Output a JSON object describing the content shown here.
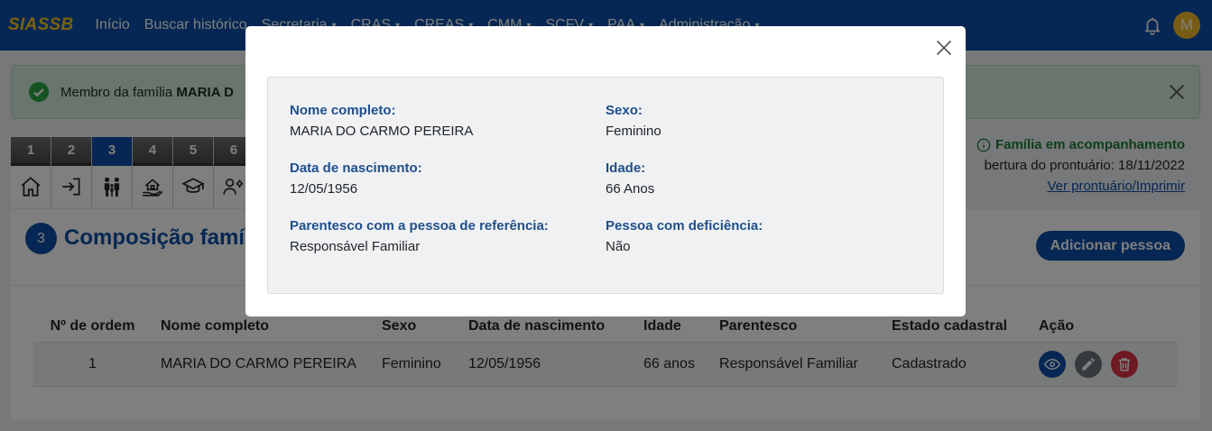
{
  "navbar": {
    "brand": "SIASSB",
    "items": [
      {
        "label": "Início",
        "has_caret": false
      },
      {
        "label": "Buscar histórico",
        "has_caret": false
      },
      {
        "label": "Secretaria",
        "has_caret": true
      },
      {
        "label": "CRAS",
        "has_caret": true
      },
      {
        "label": "CREAS",
        "has_caret": true
      },
      {
        "label": "CMM",
        "has_caret": true
      },
      {
        "label": "SCFV",
        "has_caret": true
      },
      {
        "label": "PAA",
        "has_caret": true
      },
      {
        "label": "Administração",
        "has_caret": true
      }
    ],
    "caret": "▾",
    "avatar_initial": "M",
    "icons": [
      "bell-icon",
      "avatar"
    ]
  },
  "alert": {
    "text_prefix": "Membro da família ",
    "text_name": "MARIA D",
    "icons": [
      "check-circle-icon",
      "close-icon"
    ]
  },
  "steps": {
    "active": "3",
    "items": [
      {
        "num": "1",
        "icon": "home-icon"
      },
      {
        "num": "2",
        "icon": "sign-in-icon"
      },
      {
        "num": "3",
        "icon": "family-icon"
      },
      {
        "num": "4",
        "icon": "house-hand-icon"
      },
      {
        "num": "5",
        "icon": "graduation-cap-icon"
      },
      {
        "num": "6",
        "icon": "people-gear-icon"
      }
    ]
  },
  "status": {
    "following": "Família em acompanhamento",
    "opening": "bertura do prontuário: 18/11/2022",
    "link": "Ver prontuário/Imprimir"
  },
  "section": {
    "number": "3",
    "title": "Composição famíl",
    "add_button": "Adicionar pessoa"
  },
  "table": {
    "headers": [
      "Nº de ordem",
      "Nome completo",
      "Sexo",
      "Data de nascimento",
      "Idade",
      "Parentesco",
      "Estado cadastral",
      "Ação"
    ],
    "rows": [
      [
        "1",
        "MARIA DO CARMO PEREIRA",
        "Feminino",
        "12/05/1956",
        "66 anos",
        "Responsável Familiar",
        "Cadastrado"
      ]
    ],
    "actions": [
      {
        "icon": "eye-icon",
        "color": "#0d4ea6"
      },
      {
        "icon": "pencil-icon",
        "color": "#6c757d"
      },
      {
        "icon": "trash-icon",
        "color": "#dc3545"
      }
    ]
  },
  "modal": {
    "fields": [
      {
        "label": "Nome completo:",
        "value": "MARIA DO CARMO PEREIRA"
      },
      {
        "label": "Sexo:",
        "value": "Feminino"
      },
      {
        "label": "Data de nascimento:",
        "value": "12/05/1956"
      },
      {
        "label": "Idade:",
        "value": "66 Anos"
      },
      {
        "label": "Parentesco com a pessoa de referência:",
        "value": "Responsável Familiar"
      },
      {
        "label": "Pessoa com deficiência:",
        "value": "Não"
      }
    ]
  },
  "colors": {
    "primary": "#0d4ea6",
    "brand_yellow": "#f5c518",
    "success_bg": "#d4eddb",
    "success_text": "#1e7d3b",
    "danger": "#dc3545",
    "secondary": "#6c757d"
  }
}
